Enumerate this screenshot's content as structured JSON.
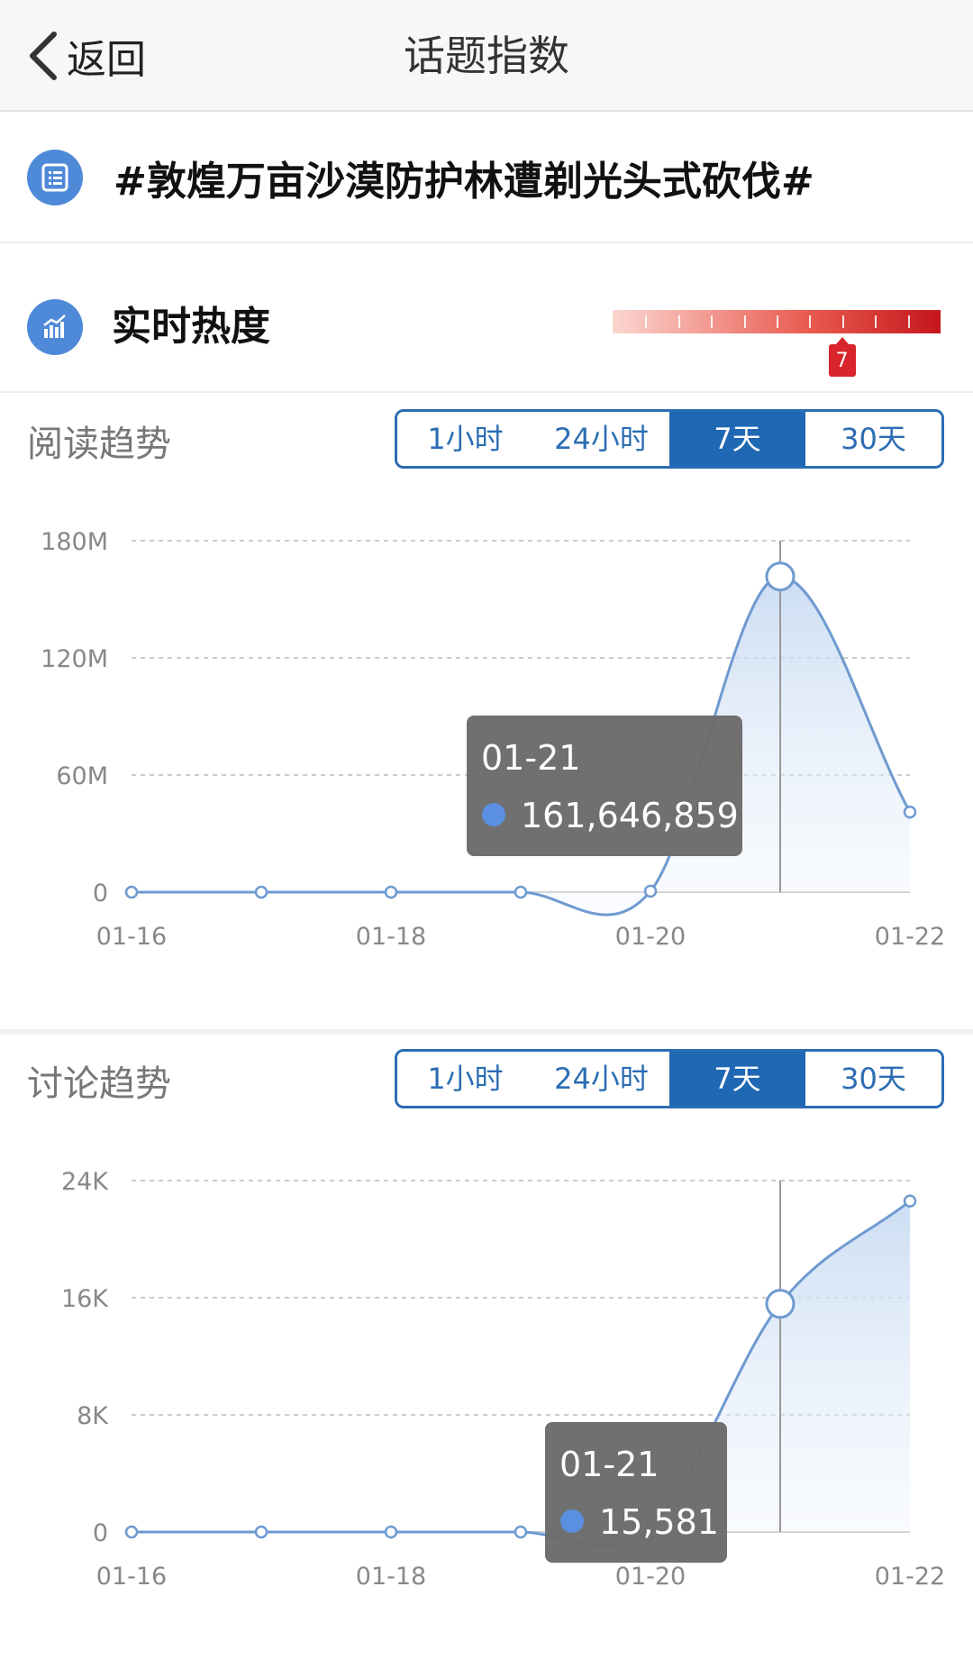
{
  "nav": {
    "back_label": "返回",
    "title": "话题指数"
  },
  "topic": {
    "title": "#敦煌万亩沙漠防护林遭剃光头式砍伐#",
    "icon": "list-icon"
  },
  "heat": {
    "label": "实时热度",
    "icon": "trend-chart-icon",
    "level": 7,
    "level_max": 10,
    "marker_text": "7"
  },
  "colors": {
    "accent": "#1f68b3",
    "line": "#6e9ad0",
    "heat_dark": "#c4161c",
    "tooltip_bg": "#6b6b6b"
  },
  "read_section": {
    "title": "阅读趋势",
    "tabs": [
      {
        "label": "1小时",
        "active": false
      },
      {
        "label": "24小时",
        "active": false
      },
      {
        "label": "7天",
        "active": true
      },
      {
        "label": "30天",
        "active": false
      }
    ],
    "tooltip": {
      "date": "01-21",
      "value": "161,646,859"
    }
  },
  "discuss_section": {
    "title": "讨论趋势",
    "tabs": [
      {
        "label": "1小时",
        "active": false
      },
      {
        "label": "24小时",
        "active": false
      },
      {
        "label": "7天",
        "active": true
      },
      {
        "label": "30天",
        "active": false
      }
    ],
    "tooltip": {
      "date": "01-21",
      "value": "15,581"
    }
  },
  "chart_data": [
    {
      "type": "area",
      "title": "阅读趋势",
      "x": [
        "01-16",
        "01-17",
        "01-18",
        "01-19",
        "01-20",
        "01-21",
        "01-22"
      ],
      "x_tick_labels": [
        "01-16",
        "01-18",
        "01-20",
        "01-22"
      ],
      "y_tick_labels": [
        "0",
        "60M",
        "120M",
        "180M"
      ],
      "y_ticks": [
        0,
        60000000,
        120000000,
        180000000
      ],
      "ylim": [
        0,
        180000000
      ],
      "series": [
        {
          "values": [
            0,
            0,
            0,
            0,
            500000,
            161646859,
            41000000
          ]
        }
      ],
      "highlight_index": 5,
      "grid": true
    },
    {
      "type": "area",
      "title": "讨论趋势",
      "x": [
        "01-16",
        "01-17",
        "01-18",
        "01-19",
        "01-20",
        "01-21",
        "01-22"
      ],
      "x_tick_labels": [
        "01-16",
        "01-18",
        "01-20",
        "01-22"
      ],
      "y_tick_labels": [
        "0",
        "8K",
        "16K",
        "24K"
      ],
      "y_ticks": [
        0,
        8000,
        16000,
        24000
      ],
      "ylim": [
        0,
        24000
      ],
      "series": [
        {
          "values": [
            0,
            0,
            0,
            0,
            300,
            15581,
            22600
          ]
        }
      ],
      "highlight_index": 5,
      "grid": true
    }
  ]
}
